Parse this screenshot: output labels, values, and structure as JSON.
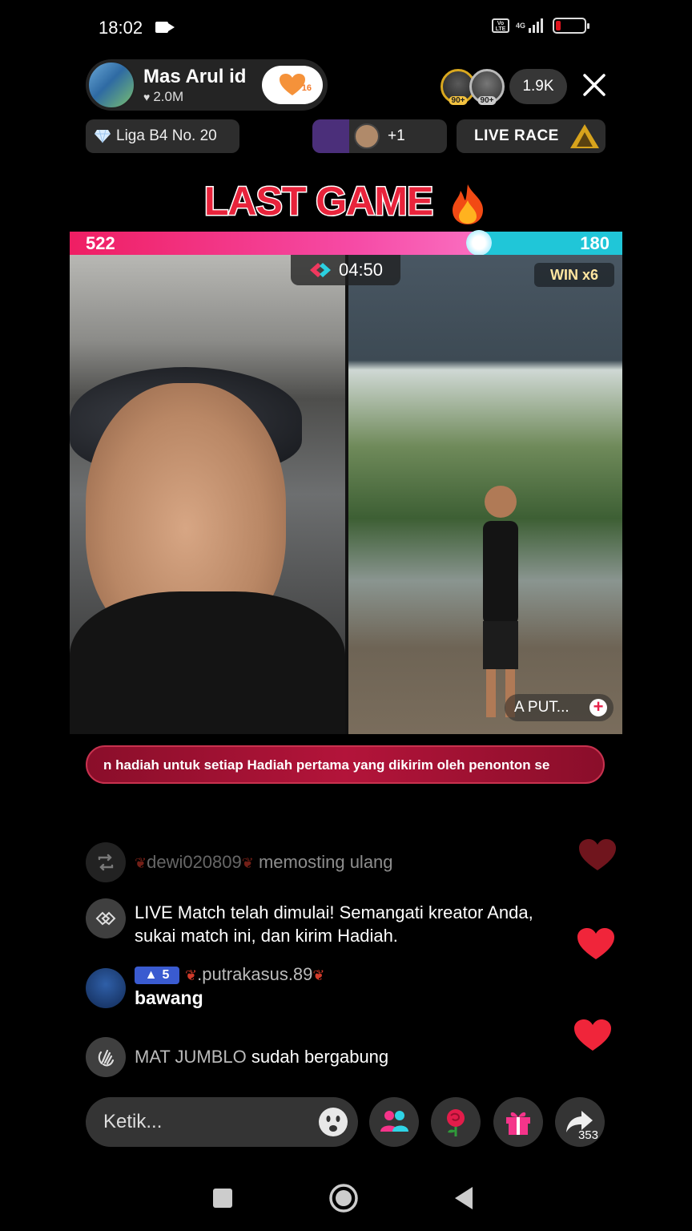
{
  "status_bar": {
    "time": "18:02",
    "network": "4G",
    "volte": "Vo LTE"
  },
  "host": {
    "name": "Mas Arul id",
    "likes": "2.0M",
    "follow_count": "16"
  },
  "viewers": {
    "badge1": "90+",
    "badge2": "90+",
    "count": "1.9K"
  },
  "league": {
    "label": "Liga B4 No. 20"
  },
  "gifters": {
    "more": "+1"
  },
  "live_race": {
    "label": "LIVE RACE"
  },
  "banner": {
    "title": "LAST GAME"
  },
  "battle": {
    "left_score": "522",
    "right_score": "180",
    "left_share": 0.74,
    "timer": "04:50",
    "win_streak": "WIN x6",
    "opponent_name": "A PUT..."
  },
  "ticker": {
    "text": "n hadiah untuk setiap Hadiah pertama yang dikirim oleh penonton se"
  },
  "comments": {
    "c1": {
      "user": "dewi020809",
      "action": "memosting ulang"
    },
    "c2": {
      "line1": "LIVE Match telah dimulai! Semangati kreator Anda,",
      "line2": "sukai match ini, dan kirim Hadiah."
    },
    "c3": {
      "level": "5",
      "user": ".putrakasus.89",
      "message": "bawang"
    },
    "c4": {
      "user": "MAT JUMBLO",
      "action": "sudah bergabung"
    }
  },
  "input": {
    "placeholder": "Ketik..."
  },
  "share": {
    "count": "353"
  },
  "colors": {
    "accent_pink": "#ef1e63",
    "accent_cyan": "#20c6d8",
    "ticker": "#b3143a"
  }
}
